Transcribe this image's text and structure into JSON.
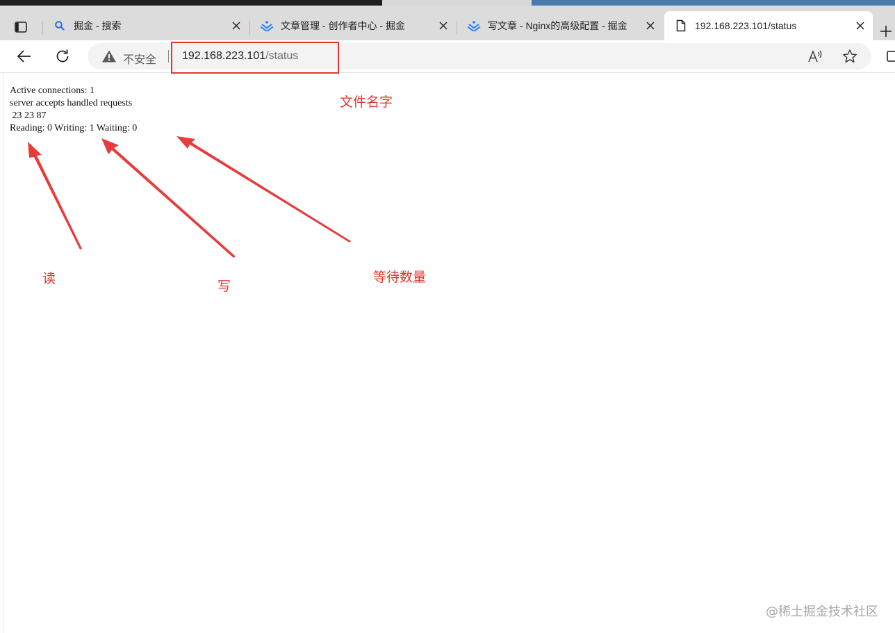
{
  "browser": {
    "tabs": [
      {
        "title": "掘金 - 搜索",
        "favicon": "search-icon",
        "active": false
      },
      {
        "title": "文章管理 - 创作者中心 - 掘金",
        "favicon": "juejin-logo-icon",
        "active": false
      },
      {
        "title": "写文章 - Nginx的高级配置 - 掘金",
        "favicon": "juejin-logo-icon",
        "active": false
      },
      {
        "title": "192.168.223.101/status",
        "favicon": "document-icon",
        "active": true
      }
    ],
    "security_label": "不安全",
    "url_host": "192.168.223.101",
    "url_path": "/status"
  },
  "page": {
    "status_text": "Active connections: 1 \nserver accepts handled requests\n 23 23 87 \nReading: 0 Writing: 1 Waiting: 0 "
  },
  "annotations": {
    "filename_label": "文件名字",
    "reading_label": "读",
    "writing_label": "写",
    "waiting_label": "等待数量",
    "color": "#e0362e"
  },
  "watermark": "@稀土掘金技术社区"
}
